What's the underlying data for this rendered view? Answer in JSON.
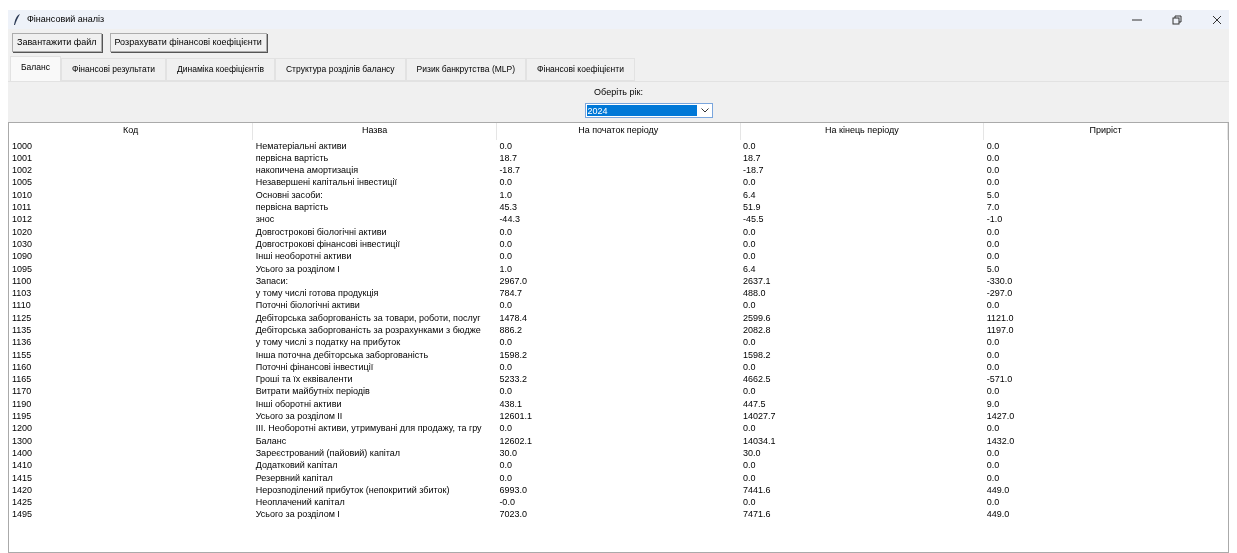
{
  "window": {
    "title": "Фінансовий аналіз"
  },
  "toolbar": {
    "buttons": [
      "Завантажити файл",
      "Розрахувати фінансові коефіцієнти"
    ]
  },
  "tabs": [
    {
      "label": "Баланс",
      "selected": true
    },
    {
      "label": "Фінансові результати",
      "selected": false
    },
    {
      "label": "Динаміка коефіцієнтів",
      "selected": false
    },
    {
      "label": "Структура розділів балансу",
      "selected": false
    },
    {
      "label": "Ризик банкрутства (MLP)",
      "selected": false
    },
    {
      "label": "Фінансові коефіцієнти",
      "selected": false
    }
  ],
  "year_picker": {
    "label": "Оберіть рік:",
    "value": "2024"
  },
  "table": {
    "columns": [
      "Код",
      "Назва",
      "На початок періоду",
      "На кінець періоду",
      "Приріст"
    ],
    "rows": [
      [
        "1000",
        "Нематеріальні активи",
        "0.0",
        "0.0",
        "0.0"
      ],
      [
        "1001",
        "первісна вартість",
        "18.7",
        "18.7",
        "0.0"
      ],
      [
        "1002",
        "накопичена амортизація",
        "-18.7",
        "-18.7",
        "0.0"
      ],
      [
        "1005",
        "Незавершені капітальні інвестиції",
        "0.0",
        "0.0",
        "0.0"
      ],
      [
        "1010",
        "Основні засоби:",
        "1.0",
        "6.4",
        "5.0"
      ],
      [
        "1011",
        "первісна вартість",
        "45.3",
        "51.9",
        "7.0"
      ],
      [
        "1012",
        "знос",
        "-44.3",
        "-45.5",
        "-1.0"
      ],
      [
        "1020",
        "Довгострокові біологічні активи",
        "0.0",
        "0.0",
        "0.0"
      ],
      [
        "1030",
        "Довгострокові фінансові інвестиції",
        "0.0",
        "0.0",
        "0.0"
      ],
      [
        "1090",
        "Інші необоротні активи",
        "0.0",
        "0.0",
        "0.0"
      ],
      [
        "1095",
        "Усього за розділом I",
        "1.0",
        "6.4",
        "5.0"
      ],
      [
        "1100",
        "Запаси:",
        "2967.0",
        "2637.1",
        "-330.0"
      ],
      [
        "1103",
        "у тому числі готова продукція",
        "784.7",
        "488.0",
        "-297.0"
      ],
      [
        "1110",
        "Поточні біологічні активи",
        "0.0",
        "0.0",
        "0.0"
      ],
      [
        "1125",
        "Дебіторська заборгованість за товари, роботи, послуг",
        "1478.4",
        "2599.6",
        "1121.0"
      ],
      [
        "1135",
        "Дебіторська заборгованість за розрахунками з бюдже",
        "886.2",
        "2082.8",
        "1197.0"
      ],
      [
        "1136",
        "у тому числі з податку на прибуток",
        "0.0",
        "0.0",
        "0.0"
      ],
      [
        "1155",
        "Інша поточна дебіторська заборгованість",
        "1598.2",
        "1598.2",
        "0.0"
      ],
      [
        "1160",
        "Поточні фінансові інвестиції",
        "0.0",
        "0.0",
        "0.0"
      ],
      [
        "1165",
        "Гроші та їх еквіваленти",
        "5233.2",
        "4662.5",
        "-571.0"
      ],
      [
        "1170",
        "Витрати майбутніх періодів",
        "0.0",
        "0.0",
        "0.0"
      ],
      [
        "1190",
        "Інші оборотні активи",
        "438.1",
        "447.5",
        "9.0"
      ],
      [
        "1195",
        "Усього за розділом II",
        "12601.1",
        "14027.7",
        "1427.0"
      ],
      [
        "1200",
        "III. Необоротні активи, утримувані для продажу, та гру",
        "0.0",
        "0.0",
        "0.0"
      ],
      [
        "1300",
        "Баланс",
        "12602.1",
        "14034.1",
        "1432.0"
      ],
      [
        "1400",
        "Зареєстрований (пайовий) капітал",
        "30.0",
        "30.0",
        "0.0"
      ],
      [
        "1410",
        "Додатковий капітал",
        "0.0",
        "0.0",
        "0.0"
      ],
      [
        "1415",
        "Резервний капітал",
        "0.0",
        "0.0",
        "0.0"
      ],
      [
        "1420",
        "Нерозподілений прибуток (непокритий збиток)",
        "6993.0",
        "7441.6",
        "449.0"
      ],
      [
        "1425",
        "Неоплачений капітал",
        "-0.0",
        "0.0",
        "0.0"
      ],
      [
        "1495",
        "Усього за розділом I",
        "7023.0",
        "7471.6",
        "449.0"
      ]
    ]
  }
}
